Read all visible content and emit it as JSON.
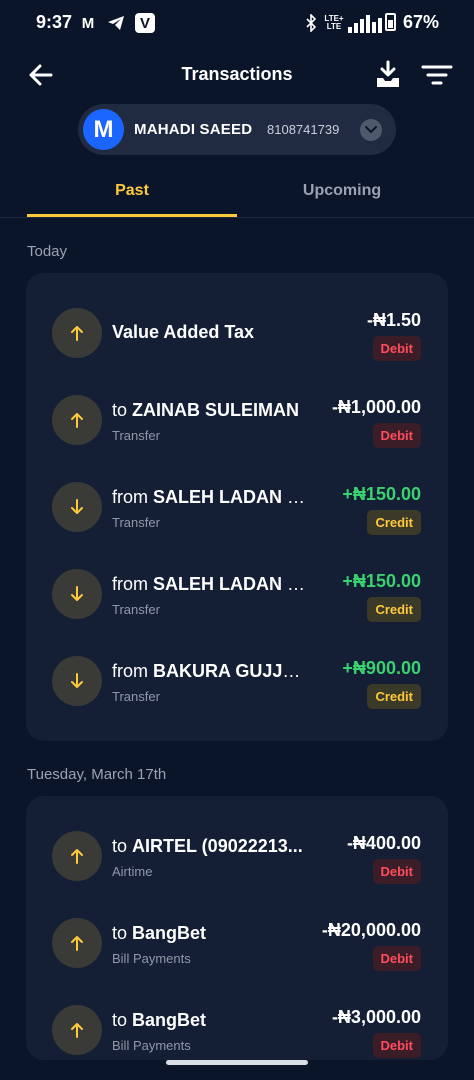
{
  "status_bar": {
    "time": "9:37",
    "gmail_glyph": "M",
    "vpn_glyph": "V",
    "lte_top": "LTE+",
    "lte_bottom": "LTE",
    "battery": "67%"
  },
  "header": {
    "title": "Transactions",
    "back_icon": "arrow-left-icon",
    "download_icon": "download-tray-icon",
    "filter_icon": "filter-icon"
  },
  "account": {
    "avatar_letter": "M",
    "name": "MAHADI SAEED",
    "number": "8108741739",
    "avatar_color": "#1a66ff"
  },
  "tabs": [
    {
      "label": "Past",
      "active": true
    },
    {
      "label": "Upcoming",
      "active": false
    }
  ],
  "colors": {
    "accent": "#ffc93c",
    "credit": "#3bd16f",
    "debit_badge_text": "#ff4d5e",
    "background": "#0b1529",
    "card": "#141f35"
  },
  "sections": [
    {
      "date": "Today",
      "transactions": [
        {
          "prefix": "",
          "name": "Value Added Tax",
          "subtitle": "",
          "amount": "-₦1.50",
          "type": "Debit",
          "direction": "up"
        },
        {
          "prefix": "to ",
          "name": "ZAINAB SULEIMAN",
          "subtitle": "Transfer",
          "amount": "-₦1,000.00",
          "type": "Debit",
          "direction": "up"
        },
        {
          "prefix": "from ",
          "name": "SALEH LADAN MUSA",
          "subtitle": "Transfer",
          "amount": "+₦150.00",
          "type": "Credit",
          "direction": "down"
        },
        {
          "prefix": "from ",
          "name": "SALEH LADAN MUSA",
          "subtitle": "Transfer",
          "amount": "+₦150.00",
          "type": "Credit",
          "direction": "down"
        },
        {
          "prefix": "from ",
          "name": "BAKURA GUJJA ABUBAKAR",
          "subtitle": "Transfer",
          "amount": "+₦900.00",
          "type": "Credit",
          "direction": "down"
        }
      ]
    },
    {
      "date": "Tuesday, March 17th",
      "transactions": [
        {
          "prefix": "to ",
          "name": "AIRTEL (09022213...",
          "subtitle": "Airtime",
          "amount": "-₦400.00",
          "type": "Debit",
          "direction": "up"
        },
        {
          "prefix": "to ",
          "name": "BangBet",
          "subtitle": "Bill Payments",
          "amount": "-₦20,000.00",
          "type": "Debit",
          "direction": "up"
        },
        {
          "prefix": "to ",
          "name": "BangBet",
          "subtitle": "Bill Payments",
          "amount": "-₦3,000.00",
          "type": "Debit",
          "direction": "up"
        }
      ]
    }
  ]
}
